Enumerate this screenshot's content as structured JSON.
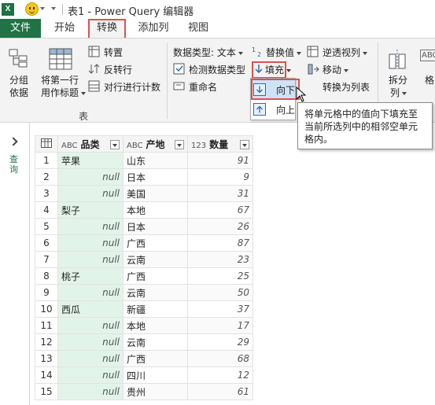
{
  "title_bar": {
    "app_icon": "X",
    "window_title": "表1 - Power Query 编辑器"
  },
  "tabs": {
    "file": "文件",
    "home": "开始",
    "transform": "转换",
    "add_column": "添加列",
    "view": "视图"
  },
  "ribbon": {
    "table_group": {
      "group_by": [
        "分组",
        "依据"
      ],
      "use_first_row": [
        "将第一行",
        "用作标题"
      ],
      "transpose": "转置",
      "reverse_rows": "反转行",
      "count_rows": "对行进行计数",
      "group_label": "表"
    },
    "any_column_group": {
      "data_type": "数据类型: 文本",
      "detect_type": "检测数据类型",
      "rename": "重命名",
      "replace_values": "替换值",
      "fill": "填充",
      "unpivot": "逆透视列",
      "move": "移动",
      "convert_to_list": "转换为列表"
    },
    "text_group": {
      "split_column": [
        "拆分",
        "列"
      ],
      "format_partial": "格"
    },
    "fill_menu": {
      "down": "向下",
      "up": "向上"
    }
  },
  "tooltip": "将单元格中的值向下填充至当前所选列中的相邻空单元格内。",
  "left_panel": {
    "queries_label": "查询"
  },
  "table": {
    "columns": [
      {
        "type": "ABC",
        "name": "品类"
      },
      {
        "type": "ABC",
        "name": "产地"
      },
      {
        "type": "123",
        "name": "数量"
      }
    ],
    "rows": [
      {
        "idx": "1",
        "cat": "苹果",
        "place": "山东",
        "qty": "91"
      },
      {
        "idx": "2",
        "cat": "null",
        "place": "日本",
        "qty": "9"
      },
      {
        "idx": "3",
        "cat": "null",
        "place": "美国",
        "qty": "31"
      },
      {
        "idx": "4",
        "cat": "梨子",
        "place": "本地",
        "qty": "67"
      },
      {
        "idx": "5",
        "cat": "null",
        "place": "日本",
        "qty": "26"
      },
      {
        "idx": "6",
        "cat": "null",
        "place": "广西",
        "qty": "87"
      },
      {
        "idx": "7",
        "cat": "null",
        "place": "云南",
        "qty": "23"
      },
      {
        "idx": "8",
        "cat": "桃子",
        "place": "广西",
        "qty": "25"
      },
      {
        "idx": "9",
        "cat": "null",
        "place": "云南",
        "qty": "50"
      },
      {
        "idx": "10",
        "cat": "西瓜",
        "place": "新疆",
        "qty": "37"
      },
      {
        "idx": "11",
        "cat": "null",
        "place": "本地",
        "qty": "17"
      },
      {
        "idx": "12",
        "cat": "null",
        "place": "云南",
        "qty": "29"
      },
      {
        "idx": "13",
        "cat": "null",
        "place": "广西",
        "qty": "68"
      },
      {
        "idx": "14",
        "cat": "null",
        "place": "四川",
        "qty": "12"
      },
      {
        "idx": "15",
        "cat": "null",
        "place": "贵州",
        "qty": "61"
      }
    ]
  }
}
